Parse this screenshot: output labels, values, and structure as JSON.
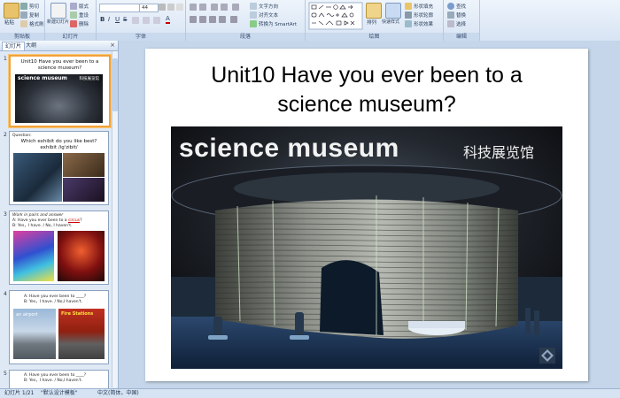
{
  "ribbon": {
    "clipboard": {
      "group_label": "剪贴板",
      "paste": "粘贴",
      "cut": "剪切",
      "copy": "复制",
      "format_painter": "格式刷"
    },
    "slides": {
      "group_label": "幻灯片",
      "new_slide": "新建幻灯片",
      "layout": "版式",
      "reset": "重设",
      "delete": "删除"
    },
    "font": {
      "group_label": "字体",
      "size": "44"
    },
    "paragraph": {
      "group_label": "段落",
      "text_direction": "文字方向",
      "align_text": "对齐文本",
      "smartart": "转换为 SmartArt"
    },
    "drawing": {
      "group_label": "绘图",
      "arrange": "排列",
      "quick_styles": "快速样式",
      "shape_fill": "形状填充",
      "shape_outline": "形状轮廓",
      "shape_effects": "形状效果"
    },
    "editing": {
      "group_label": "编辑",
      "find": "查找",
      "replace": "替换",
      "select": "选择"
    }
  },
  "panel": {
    "tabs": [
      "幻灯片",
      "大纲"
    ],
    "close": "×",
    "thumbnails": [
      {
        "num": "1",
        "title": "Unit10 Have you ever been to a science museum?",
        "banner": "science museum",
        "banner_cn": "科技展览馆"
      },
      {
        "num": "2",
        "label": "Question:",
        "title": "Which exhibit do you like best?",
        "sub": "exhibit  /ig'zibit/"
      },
      {
        "num": "3",
        "line1": "Work in pairs and answer",
        "line2a": "A: Have you ever been to a ",
        "line2b": "circus",
        "line2c": "?",
        "line3": "B: Yes，I have. / No, I haven't."
      },
      {
        "num": "4",
        "line1": "A: Have you ever been to ____?",
        "line2": "B: Yes，I have. / No,I haven't.",
        "photo1": "an airport",
        "photo2": "Fire Stations"
      },
      {
        "num": "5",
        "line1": "A: Have you ever been to ____?",
        "line2": "B: Yes，I have. / No,I haven't."
      }
    ]
  },
  "slide": {
    "title_line1": "Unit10 Have you ever been to a",
    "title_line2": "science museum?",
    "image_text_en": "science museum",
    "image_text_cn": "科技展览馆"
  },
  "status": {
    "slide_info": "幻灯片 1/21",
    "theme": "\"默认设计模板\"",
    "language": "中文(简体，中国)"
  }
}
